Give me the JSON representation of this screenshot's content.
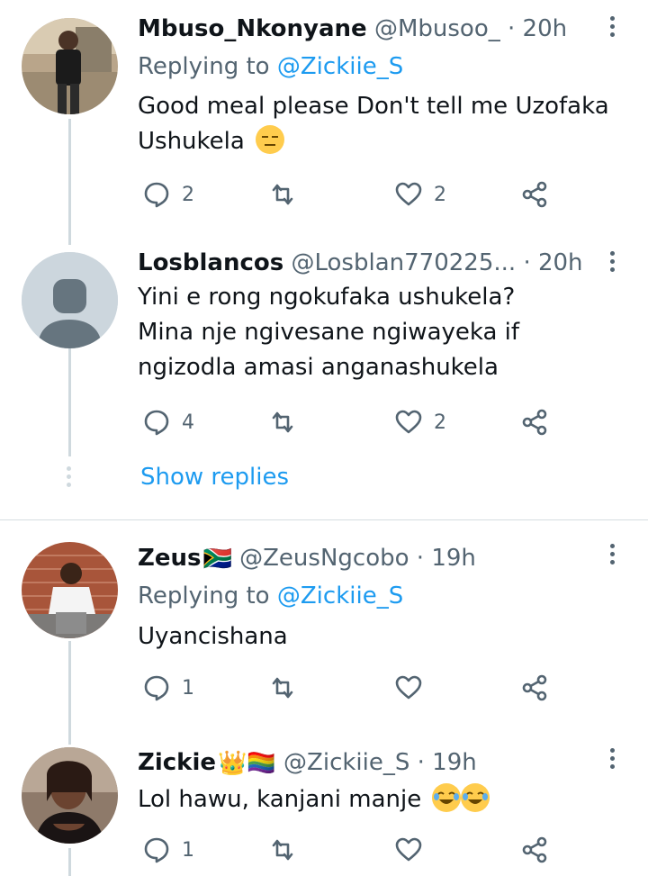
{
  "tweets": [
    {
      "name": "Mbuso_Nkonyane",
      "handle": "@Mbusoo_",
      "dot": "·",
      "time": "20h",
      "reply_label": "Replying to",
      "reply_to": "@Zickiie_S",
      "text_line1": "Good meal please Don't tell me Uzofaka",
      "text_line2": "Ushukela",
      "emoji": "😑",
      "reply_count": "2",
      "retweet_count": "",
      "like_count": "2"
    },
    {
      "name": "Losblancos",
      "handle": "@Losblan770225...",
      "dot": "·",
      "time": "20h",
      "text_line1": "Yini e rong ngokufaka ushukela?",
      "text_line2": "Mina nje ngivesane ngiwayeka if",
      "text_line3": "ngizodla amasi anganashukela",
      "reply_count": "4",
      "retweet_count": "",
      "like_count": "2"
    },
    {
      "name": "Zeus",
      "flag": "🇿🇦",
      "handle": "@ZeusNgcobo",
      "dot": "·",
      "time": "19h",
      "reply_label": "Replying to",
      "reply_to": "@Zickiie_S",
      "text_line1": "Uyancishana",
      "reply_count": "1",
      "retweet_count": "",
      "like_count": ""
    },
    {
      "name": "Zickie",
      "name_emojis": "👑🏳️‍🌈",
      "handle": "@Zickiie_S",
      "dot": "·",
      "time": "19h",
      "text_line1": "Lol hawu, kanjani manje",
      "emoji": "😂😂",
      "reply_count": "1",
      "retweet_count": "",
      "like_count": ""
    }
  ],
  "show_replies": "Show replies",
  "colors": {
    "accent": "#1d9bf0",
    "secondary_text": "#536471",
    "thread_line": "#cfd9de"
  }
}
